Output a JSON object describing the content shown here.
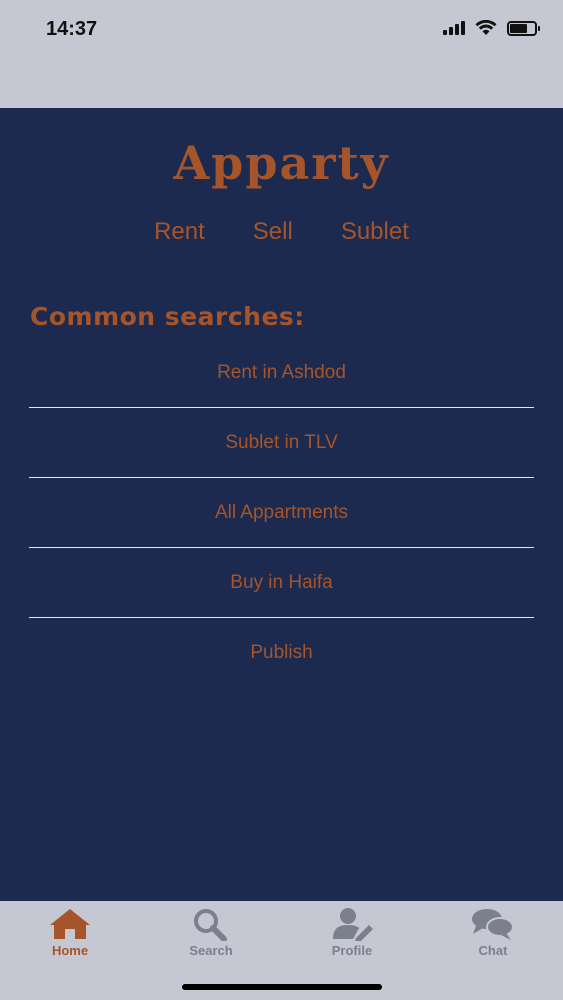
{
  "status_bar": {
    "time": "14:37"
  },
  "app": {
    "title": "Apparty"
  },
  "top_tabs": [
    {
      "label": "Rent"
    },
    {
      "label": "Sell"
    },
    {
      "label": "Sublet"
    }
  ],
  "common_searches": {
    "title": "Common searches:",
    "items": [
      {
        "label": "Rent in Ashdod"
      },
      {
        "label": "Sublet in TLV"
      },
      {
        "label": "All Appartments"
      },
      {
        "label": "Buy in Haifa"
      },
      {
        "label": "Publish"
      }
    ]
  },
  "tab_bar": {
    "items": [
      {
        "label": "Home",
        "icon": "home-icon",
        "active": true
      },
      {
        "label": "Search",
        "icon": "search-icon",
        "active": false
      },
      {
        "label": "Profile",
        "icon": "profile-edit-icon",
        "active": false
      },
      {
        "label": "Chat",
        "icon": "chat-icon",
        "active": false
      }
    ]
  },
  "colors": {
    "background": "#1c2a4f",
    "accent": "#a6552a",
    "bar": "#c5c8d3",
    "inactive": "#7c7f8c"
  }
}
